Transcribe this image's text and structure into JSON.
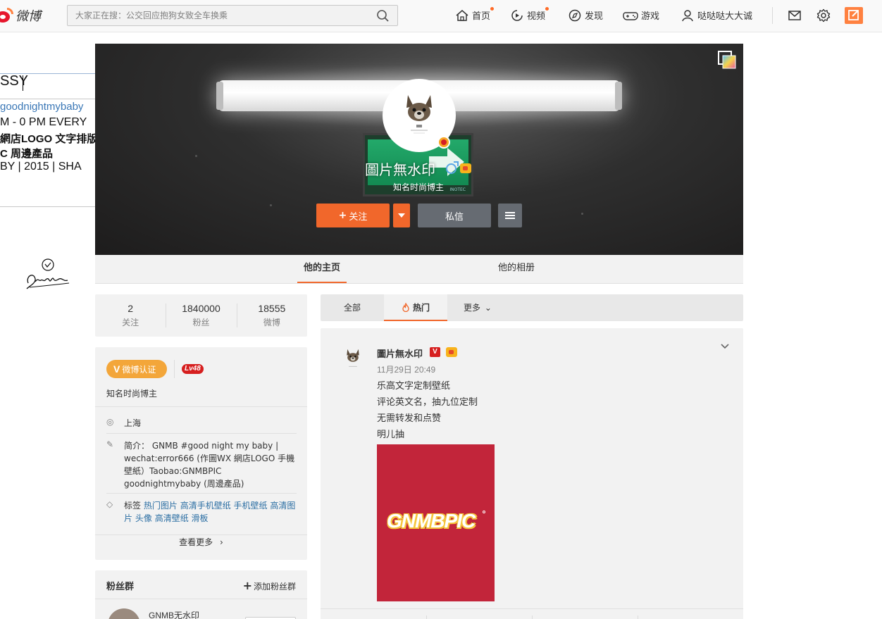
{
  "topbar": {
    "logo_text": "微博",
    "search_placeholder": "大家正在搜：公交回应抱狗女致全车换乘",
    "nav": {
      "home": "首页",
      "video": "视频",
      "discover": "发现",
      "game": "游戏",
      "user": "哒哒哒大大诚"
    },
    "colors": {
      "accent": "#ff8140",
      "notify_dot": "#ff6a26"
    },
    "icons": [
      "logo-icon",
      "search-icon",
      "home-icon",
      "video-icon",
      "discover-icon",
      "game-icon",
      "user-icon",
      "mail-icon",
      "gear-icon",
      "compose-icon"
    ]
  },
  "background": {
    "input_text": "SSY",
    "lines": [
      "goodnightmybaby",
      "M - 0 PM    EVERY",
      "網店LOGO 文字排版",
      "C 周邊產品",
      "BY  |  2015  |  SHA"
    ]
  },
  "profile": {
    "name": "圖片無水印",
    "description": "知名时尚博主",
    "follow_label": "关注",
    "follow_plus": "+",
    "message_label": "私信",
    "cover_sign_text": "INOTEC",
    "colors": {
      "follow": "#f1672b",
      "secondary": "#666b72"
    },
    "icons": [
      "skin-icon",
      "verified-icon",
      "gender-male-icon",
      "crown-icon",
      "caret-down-icon",
      "menu-icon"
    ]
  },
  "profile_tabs": [
    {
      "label": "他的主页",
      "active": true
    },
    {
      "label": "他的相册",
      "active": false
    }
  ],
  "stats": [
    {
      "value": "2",
      "label": "关注"
    },
    {
      "value": "1840000",
      "label": "粉丝"
    },
    {
      "value": "18555",
      "label": "微博"
    }
  ],
  "info": {
    "badge_v": "V",
    "badge_label": "微博认证",
    "level": "Lv48",
    "description": "知名时尚博主",
    "location_icon": "◎",
    "location": "上海",
    "bio_icon": "✎",
    "bio": "简介： GNMB #good night my baby | wechat:error666 (作圖WX 網店LOGO 手機壁紙）Taobao:GNMBPIC goodnightmybaby (周邊產品)",
    "tags_icon": "◇",
    "tags_label": "标签",
    "tags": [
      "热门图片",
      "高清手机壁纸",
      "手机壁纸",
      "高清图片",
      "头像",
      "高清壁纸",
      "滑板"
    ],
    "more_label": "查看更多",
    "more_arrow": "›"
  },
  "fans_group": {
    "title": "粉丝群",
    "add_label": "添加粉丝群",
    "add_plus": "+",
    "group_name": "GNMB无水印"
  },
  "feed_tabs": [
    {
      "label": "全部",
      "active": false
    },
    {
      "label": "热门",
      "active": true
    },
    {
      "label": "更多",
      "active": false,
      "chevron": "⌄"
    }
  ],
  "post": {
    "author": "圖片無水印",
    "v_badge": "V",
    "time": "11月29日 20:49",
    "lines": [
      "乐高文字定制壁纸",
      "评论英文名，抽九位定制",
      "无需转发和点赞",
      "明儿抽"
    ],
    "image_text": "GNMBPIC",
    "image_color": "#c2253a"
  }
}
